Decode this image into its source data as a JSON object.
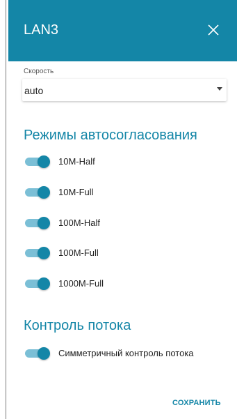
{
  "header": {
    "title": "LAN3",
    "close_icon": "close-icon"
  },
  "speed": {
    "label": "Скорость",
    "value": "auto"
  },
  "autoneg": {
    "title": "Режимы автосогласования",
    "modes": [
      {
        "label": "10M-Half",
        "on": true
      },
      {
        "label": "10M-Full",
        "on": true
      },
      {
        "label": "100M-Half",
        "on": true
      },
      {
        "label": "100M-Full",
        "on": true
      },
      {
        "label": "1000M-Full",
        "on": true
      }
    ]
  },
  "flow": {
    "title": "Контроль потока",
    "symmetric": {
      "label": "Симметричный контроль потока",
      "on": true
    }
  },
  "footer": {
    "save_label": "СОХРАНИТЬ"
  },
  "colors": {
    "accent": "#1486a7",
    "track": "#7bbfd6"
  }
}
